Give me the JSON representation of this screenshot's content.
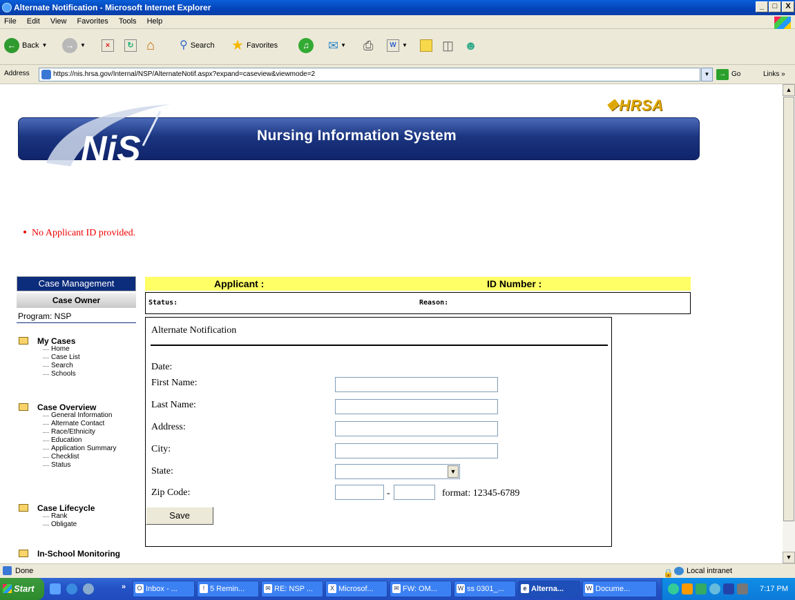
{
  "window": {
    "title": "Alternate Notification - Microsoft Internet Explorer",
    "min": "_",
    "max": "□",
    "close": "X"
  },
  "menu": [
    "File",
    "Edit",
    "View",
    "Favorites",
    "Tools",
    "Help"
  ],
  "toolbar": {
    "back": "Back",
    "search": "Search",
    "favorites": "Favorites"
  },
  "address": {
    "label": "Address",
    "url": "https://nis.hrsa.gov/Internal/NSP/AlternateNotif.aspx?expand=caseview&viewmode=2",
    "go": "Go",
    "links": "Links »"
  },
  "header": {
    "logo_text": "HRSA",
    "nis_logo": "NiS",
    "title": "Nursing Information System"
  },
  "error": "No Applicant ID provided.",
  "sidebar": {
    "case_management": "Case Management",
    "case_owner": "Case Owner",
    "program": "Program: NSP",
    "groups": [
      {
        "label": "My Cases",
        "items": [
          "Home",
          "Case List",
          "Search",
          "Schools"
        ]
      },
      {
        "label": "Case Overview",
        "items": [
          "General Information",
          "Alternate Contact",
          "Race/Ethnicity",
          "Education",
          "Application Summary",
          "Checklist",
          "Status"
        ]
      },
      {
        "label": "Case Lifecycle",
        "items": [
          "Rank",
          "Obligate"
        ]
      },
      {
        "label": "In-School Monitoring",
        "items": []
      }
    ]
  },
  "applicant_bar": {
    "applicant": "Applicant :",
    "id_number": "ID Number :"
  },
  "status_row": {
    "status": "Status:",
    "reason": "Reason:"
  },
  "form": {
    "heading": "Alternate Notification",
    "date_label": "Date:",
    "first_name_label": "First Name:",
    "last_name_label": "Last Name:",
    "address_label": "Address:",
    "city_label": "City:",
    "state_label": "State:",
    "zip_label": "Zip Code:",
    "zip_dash": "-",
    "zip_format": "format: 12345-6789",
    "first_name": "",
    "last_name": "",
    "address": "",
    "city": "",
    "state": "",
    "zip1": "",
    "zip2": ""
  },
  "save_label": "Save",
  "statusbar": {
    "text": "Done",
    "zone": "Local intranet"
  },
  "taskbar": {
    "start": "Start",
    "overflow": "»",
    "tasks": [
      "Inbox - ...",
      "5 Remin...",
      "RE: NSP ...",
      "Microsof...",
      "FW: OM...",
      "ss 0301_...",
      "Alterna...",
      "Docume..."
    ],
    "clock": "7:17 PM"
  }
}
